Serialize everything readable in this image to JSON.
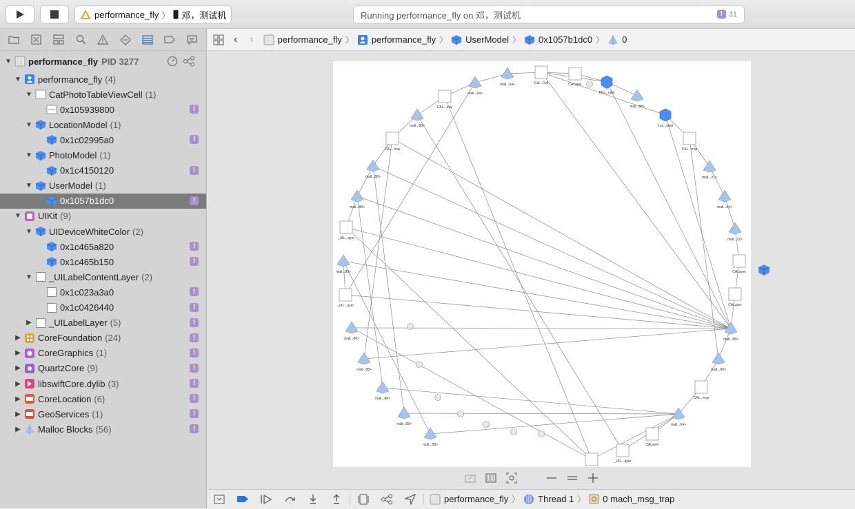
{
  "toolbar": {
    "scheme_name": "performance_fly",
    "device_name": "邓，测试机",
    "status_text": "Running performance_fly on 邓，测试机",
    "issue_count": "31"
  },
  "navigator": {
    "process_name": "performance_fly",
    "process_pid": "PID 3277",
    "badge_glyph": "!",
    "rows": [
      {
        "label": "performance_fly",
        "count": "(4)"
      },
      {
        "label": "CatPhotoTableViewCell",
        "count": "(1)"
      },
      {
        "label": "0x105939800",
        "count": ""
      },
      {
        "label": "LocationModel",
        "count": "(1)"
      },
      {
        "label": "0x1c02995a0",
        "count": ""
      },
      {
        "label": "PhotoModel",
        "count": "(1)"
      },
      {
        "label": "0x1c4150120",
        "count": ""
      },
      {
        "label": "UserModel",
        "count": "(1)"
      },
      {
        "label": "0x1057b1dc0",
        "count": ""
      },
      {
        "label": "UIKit",
        "count": "(9)"
      },
      {
        "label": "UIDeviceWhiteColor",
        "count": "(2)"
      },
      {
        "label": "0x1c465a820",
        "count": ""
      },
      {
        "label": "0x1c465b150",
        "count": ""
      },
      {
        "label": "_UILabelContentLayer",
        "count": "(2)"
      },
      {
        "label": "0x1c023a3a0",
        "count": ""
      },
      {
        "label": "0x1c0426440",
        "count": ""
      },
      {
        "label": "_UILabelLayer",
        "count": "(5)"
      },
      {
        "label": "CoreFoundation",
        "count": "(24)"
      },
      {
        "label": "CoreGraphics",
        "count": "(1)"
      },
      {
        "label": "QuartzCore",
        "count": "(9)"
      },
      {
        "label": "libswiftCore.dylib",
        "count": "(3)"
      },
      {
        "label": "CoreLocation",
        "count": "(6)"
      },
      {
        "label": "GeoServices",
        "count": "(1)"
      },
      {
        "label": "Malloc Blocks",
        "count": "(56)"
      }
    ]
  },
  "jumpbar": {
    "crumb1": "performance_fly",
    "crumb2": "performance_fly",
    "crumb3": "UserModel",
    "crumb4": "0x1057b1dc0",
    "crumb5": "0"
  },
  "debugbar": {
    "target": "performance_fly",
    "thread": "Thread 1",
    "frame": "0 mach_msg_trap"
  },
  "graph": {
    "nodes": [
      {
        "label": "Cat...Cell"
      },
      {
        "label": "CALayer"
      },
      {
        "label": "Pho...odel"
      },
      {
        "label": "mall...88>"
      },
      {
        "label": "Loc...odel"
      },
      {
        "label": "CAL...rray"
      },
      {
        "label": "mall...37>"
      },
      {
        "label": "mall...64>"
      },
      {
        "label": "mall...32>"
      },
      {
        "label": "CALayer"
      },
      {
        "label": "CALayer"
      },
      {
        "label": "mall...88>"
      },
      {
        "label": "mall...88>"
      },
      {
        "label": "CAL...rray"
      },
      {
        "label": "mall...64>"
      },
      {
        "label": "CALayer"
      },
      {
        "label": "_UIL...ayer"
      },
      {
        "label": "_UIL...ayer"
      },
      {
        "label": "moll...88>"
      },
      {
        "label": "mall...88>"
      },
      {
        "label": "mall...88>"
      },
      {
        "label": "mall...88>"
      },
      {
        "label": "mall...88>"
      },
      {
        "label": "_UIL...ayer"
      },
      {
        "label": "mall...88>"
      },
      {
        "label": "_UIL...ayer"
      },
      {
        "label": "mall...88>"
      },
      {
        "label": "mall...88>"
      },
      {
        "label": "CAL...rray"
      },
      {
        "label": "mall...88>"
      },
      {
        "label": "CAL...rray"
      },
      {
        "label": "mall...84>"
      },
      {
        "label": "mall...64>"
      }
    ]
  }
}
